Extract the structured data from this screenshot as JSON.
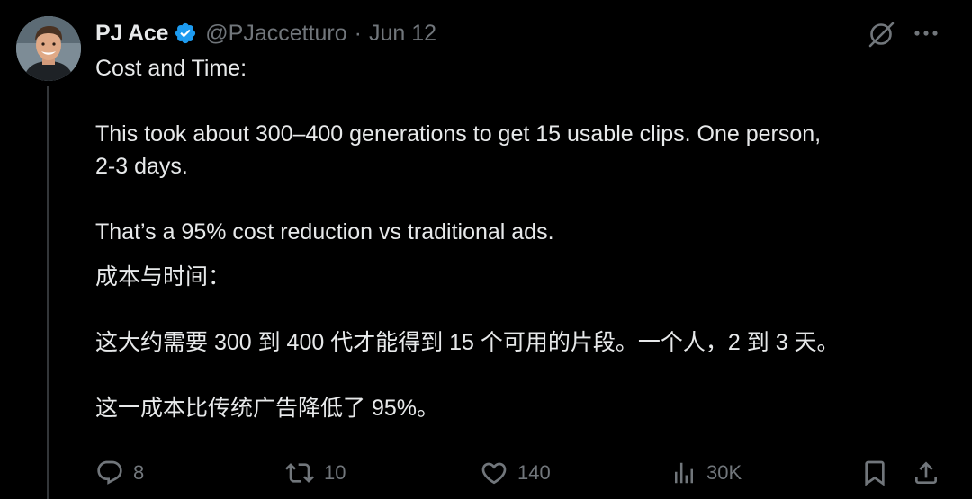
{
  "tweet": {
    "author_name": "PJ Ace",
    "handle": "@PJaccetturo",
    "separator": "·",
    "timestamp": "Jun 12",
    "text_lines": [
      "Cost and Time:",
      "This took about 300–400 generations to get 15 usable clips. One person,",
      "2-3 days.",
      "That’s a 95% cost reduction vs traditional ads.",
      "成本与时间：",
      "这大约需要 300 到 400 代才能得到 15 个可用的片段。一个人，2 到 3 天。",
      "这一成本比传统广告降低了 95%。"
    ]
  },
  "actions": {
    "replies": "8",
    "reposts": "10",
    "likes": "140",
    "views": "30K"
  },
  "icons": {
    "verified": "verified-badge-icon",
    "grok": "grok-icon",
    "more": "more-icon",
    "reply": "reply-icon",
    "repost": "repost-icon",
    "like": "heart-icon",
    "views": "views-icon",
    "bookmark": "bookmark-icon",
    "share": "share-icon"
  },
  "colors": {
    "background": "#000000",
    "text_primary": "#e7e9ea",
    "text_secondary": "#71767b",
    "verified_blue": "#1d9bf0",
    "thread_line": "#333639"
  }
}
